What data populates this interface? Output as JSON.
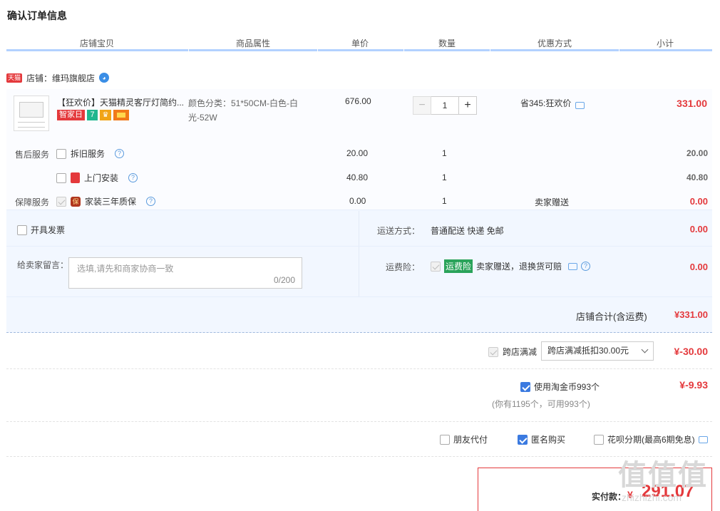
{
  "title": "确认订单信息",
  "columns": [
    "店铺宝贝",
    "商品属性",
    "单价",
    "数量",
    "优惠方式",
    "小计"
  ],
  "shop": {
    "badge": "天猫",
    "label": "店铺：维玛旗舰店"
  },
  "item": {
    "name": "【狂欢价】天猫精灵客厅灯简约...",
    "tags": [
      "智家日"
    ],
    "attr": "颜色分类：51*50CM-白色-白光-52W",
    "price": "676.00",
    "qty": "1",
    "minus": "−",
    "plus": "+",
    "promo": "省345:狂欢价",
    "subtotal": "331.00"
  },
  "services": {
    "after_sale_label": "售后服务",
    "guarantee_label": "保障服务",
    "rows": [
      {
        "name": "拆旧服务",
        "price": "20.00",
        "qty": "1",
        "promo": "",
        "subtotal": "20.00"
      },
      {
        "name": "上门安装",
        "price": "40.80",
        "qty": "1",
        "promo": "",
        "subtotal": "40.80"
      },
      {
        "name": "家装三年质保",
        "price": "0.00",
        "qty": "1",
        "promo": "卖家赠送",
        "subtotal": "0.00"
      }
    ]
  },
  "invoice": {
    "label": "开具发票"
  },
  "shipping": {
    "label": "运送方式：",
    "value": "普通配送 快递 免邮",
    "amount": "0.00"
  },
  "message": {
    "label": "给卖家留言：",
    "placeholder": "选填,请先和商家协商一致",
    "count": "0/200"
  },
  "insurance": {
    "label": "运费险：",
    "badge": "运费险",
    "text": "卖家赠送，退换货可赔",
    "amount": "0.00"
  },
  "shop_total": {
    "label": "店铺合计(含运费)",
    "value": "¥331.00"
  },
  "cross_store": {
    "label": "跨店满减",
    "select": "跨店满减抵扣30.00元",
    "value": "¥-30.00"
  },
  "coins": {
    "label": "使用淘金币993个",
    "note": "(你有1195个，可用993个)",
    "value": "¥-9.93"
  },
  "options": [
    {
      "label": "朋友代付",
      "checked": false
    },
    {
      "label": "匿名购买",
      "checked": true
    },
    {
      "label": "花呗分期(最高6期免息)",
      "checked": false
    }
  ],
  "payment": {
    "label": "实付款：",
    "currency": "¥",
    "value": "291.07"
  },
  "watermark": {
    "logo": "值值值",
    "url": "zhizhizhi.com"
  },
  "colors": {
    "accent": "#e4393c",
    "header_line": "#b2d1ff",
    "block_bg": "#f2f7ff"
  }
}
